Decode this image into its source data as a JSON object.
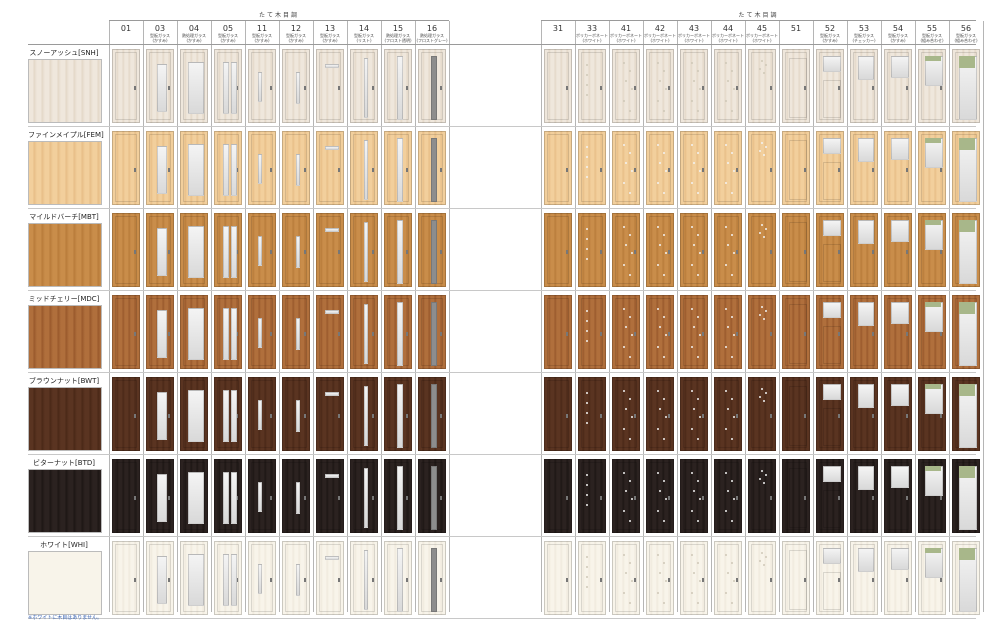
{
  "groups": [
    {
      "label": "たて木目調"
    },
    {
      "label": "たて木目調"
    }
  ],
  "columns": [
    {
      "num": "01",
      "desc": "",
      "type": "plain"
    },
    {
      "num": "03",
      "desc": "型板ガラス\n(かすみ)",
      "type": "glass-tall"
    },
    {
      "num": "04",
      "desc": "熱処理ガラス\n(かすみ)",
      "type": "glass-wide"
    },
    {
      "num": "05",
      "desc": "型板ガラス\n(かすみ)",
      "type": "glass-double"
    },
    {
      "num": "11",
      "desc": "型板ガラス\n(かすみ)",
      "type": "slit-left"
    },
    {
      "num": "12",
      "desc": "型板ガラス\n(かすみ)",
      "type": "slit-center"
    },
    {
      "num": "13",
      "desc": "型板ガラス\n(かすみ)",
      "type": "slit-top"
    },
    {
      "num": "14",
      "desc": "型板ガラス\n(リスト)",
      "type": "slit-line"
    },
    {
      "num": "15",
      "desc": "熱処理ガラス\n(フロスト透明)",
      "type": "slit-bright"
    },
    {
      "num": "16",
      "desc": "熱処理ガラス\n(フロストグレー)",
      "type": "slit-gray"
    },
    {
      "num": "31",
      "desc": "",
      "type": "plain"
    },
    {
      "num": "33",
      "desc": "ポリカーボネート\n(ホワイト)",
      "type": "dots-vert"
    },
    {
      "num": "41",
      "desc": "ポリカーボネート\n(ホワイト)",
      "type": "dots-flower"
    },
    {
      "num": "42",
      "desc": "ポリカーボネート\n(ホワイト)",
      "type": "dots-scatter"
    },
    {
      "num": "43",
      "desc": "ポリカーボネート\n(ホワイト)",
      "type": "dots-vine"
    },
    {
      "num": "44",
      "desc": "ポリカーボネート\n(ホワイト)",
      "type": "dots-vine2"
    },
    {
      "num": "45",
      "desc": "ポリカーボネート\n(ホワイト)",
      "type": "dots-top"
    },
    {
      "num": "51",
      "desc": "",
      "type": "panel"
    },
    {
      "num": "52",
      "desc": "型板ガラス\n(かすみ)",
      "type": "grid-top"
    },
    {
      "num": "53",
      "desc": "型板ガラス\n(チェッカー)",
      "type": "window-top"
    },
    {
      "num": "54",
      "desc": "型板ガラス\n(かすみ)",
      "type": "grid-4"
    },
    {
      "num": "55",
      "desc": "型板ガラス\n(組み合わせ)",
      "type": "stained-small"
    },
    {
      "num": "56",
      "desc": "型板ガラス\n(組み合わせ)",
      "type": "stained-tall"
    }
  ],
  "rows": [
    {
      "name": "スノーアッシュ[SNH]",
      "color": "#efe7dc",
      "grain": "#e3d7c7"
    },
    {
      "name": "ファインメイプル[FEM]",
      "color": "#f2cf9c",
      "grain": "#e7bd86"
    },
    {
      "name": "マイルドバーチ[MBT]",
      "color": "#c98d4a",
      "grain": "#b87b3a"
    },
    {
      "name": "ミッドチェリー[MDC]",
      "color": "#b06f3c",
      "grain": "#99592c"
    },
    {
      "name": "ブラウンナット[BWT]",
      "color": "#5a3421",
      "grain": "#4a2817"
    },
    {
      "name": "ビターナット[BTD]",
      "color": "#2b2220",
      "grain": "#1d1614"
    },
    {
      "name": "ホワイト[WHI]",
      "color": "#f8f4ea",
      "grain": "#efe9dc"
    }
  ],
  "footnote": "※ホワイトに木目はありません。"
}
